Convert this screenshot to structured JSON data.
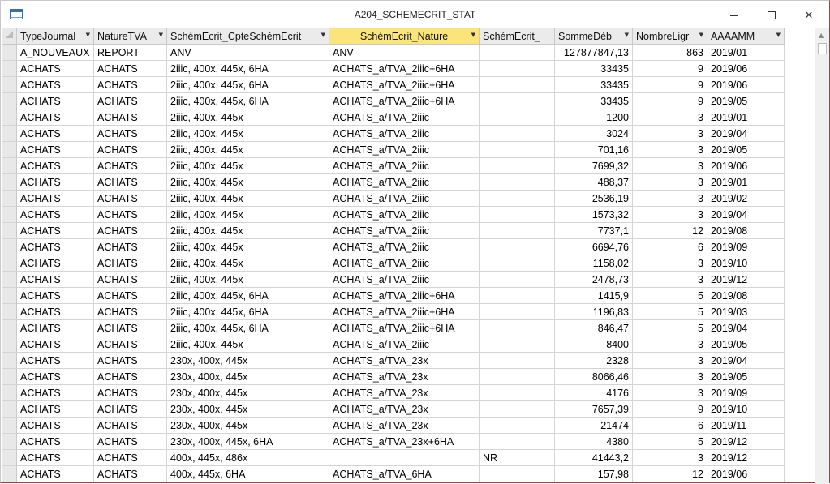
{
  "window": {
    "title": "A204_SCHEMECRIT_STAT"
  },
  "columns": [
    {
      "label": "TypeJournal",
      "has_filter": true
    },
    {
      "label": "NatureTVA",
      "has_filter": true
    },
    {
      "label": "SchémEcrit_CpteSchémEcrit",
      "has_filter": true
    },
    {
      "label": "SchémEcrit_Nature",
      "has_filter": true,
      "active": true
    },
    {
      "label": "SchémEcrit_",
      "has_filter": false
    },
    {
      "label": "SommeDéb",
      "has_filter": true
    },
    {
      "label": "NombreLigr",
      "has_filter": true
    },
    {
      "label": "AAAAMM",
      "has_filter": true
    }
  ],
  "rows": [
    [
      "A_NOUVEAUX",
      "REPORT",
      "ANV",
      "ANV",
      "",
      "127877847,13",
      "863",
      "2019/01"
    ],
    [
      "ACHATS",
      "ACHATS",
      "2iiic, 400x, 445x, 6HA",
      "ACHATS_a/TVA_2iiic+6HA",
      "",
      "33435",
      "9",
      "2019/06"
    ],
    [
      "ACHATS",
      "ACHATS",
      "2iiic, 400x, 445x, 6HA",
      "ACHATS_a/TVA_2iiic+6HA",
      "",
      "33435",
      "9",
      "2019/06"
    ],
    [
      "ACHATS",
      "ACHATS",
      "2iiic, 400x, 445x, 6HA",
      "ACHATS_a/TVA_2iiic+6HA",
      "",
      "33435",
      "9",
      "2019/05"
    ],
    [
      "ACHATS",
      "ACHATS",
      "2iiic, 400x, 445x",
      "ACHATS_a/TVA_2iiic",
      "",
      "1200",
      "3",
      "2019/01"
    ],
    [
      "ACHATS",
      "ACHATS",
      "2iiic, 400x, 445x",
      "ACHATS_a/TVA_2iiic",
      "",
      "3024",
      "3",
      "2019/04"
    ],
    [
      "ACHATS",
      "ACHATS",
      "2iiic, 400x, 445x",
      "ACHATS_a/TVA_2iiic",
      "",
      "701,16",
      "3",
      "2019/05"
    ],
    [
      "ACHATS",
      "ACHATS",
      "2iiic, 400x, 445x",
      "ACHATS_a/TVA_2iiic",
      "",
      "7699,32",
      "3",
      "2019/06"
    ],
    [
      "ACHATS",
      "ACHATS",
      "2iiic, 400x, 445x",
      "ACHATS_a/TVA_2iiic",
      "",
      "488,37",
      "3",
      "2019/01"
    ],
    [
      "ACHATS",
      "ACHATS",
      "2iiic, 400x, 445x",
      "ACHATS_a/TVA_2iiic",
      "",
      "2536,19",
      "3",
      "2019/02"
    ],
    [
      "ACHATS",
      "ACHATS",
      "2iiic, 400x, 445x",
      "ACHATS_a/TVA_2iiic",
      "",
      "1573,32",
      "3",
      "2019/04"
    ],
    [
      "ACHATS",
      "ACHATS",
      "2iiic, 400x, 445x",
      "ACHATS_a/TVA_2iiic",
      "",
      "7737,1",
      "12",
      "2019/08"
    ],
    [
      "ACHATS",
      "ACHATS",
      "2iiic, 400x, 445x",
      "ACHATS_a/TVA_2iiic",
      "",
      "6694,76",
      "6",
      "2019/09"
    ],
    [
      "ACHATS",
      "ACHATS",
      "2iiic, 400x, 445x",
      "ACHATS_a/TVA_2iiic",
      "",
      "1158,02",
      "3",
      "2019/10"
    ],
    [
      "ACHATS",
      "ACHATS",
      "2iiic, 400x, 445x",
      "ACHATS_a/TVA_2iiic",
      "",
      "2478,73",
      "3",
      "2019/12"
    ],
    [
      "ACHATS",
      "ACHATS",
      "2iiic, 400x, 445x, 6HA",
      "ACHATS_a/TVA_2iiic+6HA",
      "",
      "1415,9",
      "5",
      "2019/08"
    ],
    [
      "ACHATS",
      "ACHATS",
      "2iiic, 400x, 445x, 6HA",
      "ACHATS_a/TVA_2iiic+6HA",
      "",
      "1196,83",
      "5",
      "2019/03"
    ],
    [
      "ACHATS",
      "ACHATS",
      "2iiic, 400x, 445x, 6HA",
      "ACHATS_a/TVA_2iiic+6HA",
      "",
      "846,47",
      "5",
      "2019/04"
    ],
    [
      "ACHATS",
      "ACHATS",
      "2iiic, 400x, 445x",
      "ACHATS_a/TVA_2iiic",
      "",
      "8400",
      "3",
      "2019/05"
    ],
    [
      "ACHATS",
      "ACHATS",
      "230x, 400x, 445x",
      "ACHATS_a/TVA_23x",
      "",
      "2328",
      "3",
      "2019/04"
    ],
    [
      "ACHATS",
      "ACHATS",
      "230x, 400x, 445x",
      "ACHATS_a/TVA_23x",
      "",
      "8066,46",
      "3",
      "2019/05"
    ],
    [
      "ACHATS",
      "ACHATS",
      "230x, 400x, 445x",
      "ACHATS_a/TVA_23x",
      "",
      "4176",
      "3",
      "2019/09"
    ],
    [
      "ACHATS",
      "ACHATS",
      "230x, 400x, 445x",
      "ACHATS_a/TVA_23x",
      "",
      "7657,39",
      "9",
      "2019/10"
    ],
    [
      "ACHATS",
      "ACHATS",
      "230x, 400x, 445x",
      "ACHATS_a/TVA_23x",
      "",
      "21474",
      "6",
      "2019/11"
    ],
    [
      "ACHATS",
      "ACHATS",
      "230x, 400x, 445x, 6HA",
      "ACHATS_a/TVA_23x+6HA",
      "",
      "4380",
      "5",
      "2019/12"
    ],
    [
      "ACHATS",
      "ACHATS",
      "400x, 445x, 486x",
      "",
      "NR",
      "41443,2",
      "3",
      "2019/12"
    ],
    [
      "ACHATS",
      "ACHATS",
      "400x, 445x, 6HA",
      "ACHATS_a/TVA_6HA",
      "",
      "157,98",
      "12",
      "2019/06"
    ]
  ],
  "colors": {
    "active_header": "#fbe57a",
    "header_bg": "#ebebeb",
    "grid_line": "#d4d4d4"
  }
}
